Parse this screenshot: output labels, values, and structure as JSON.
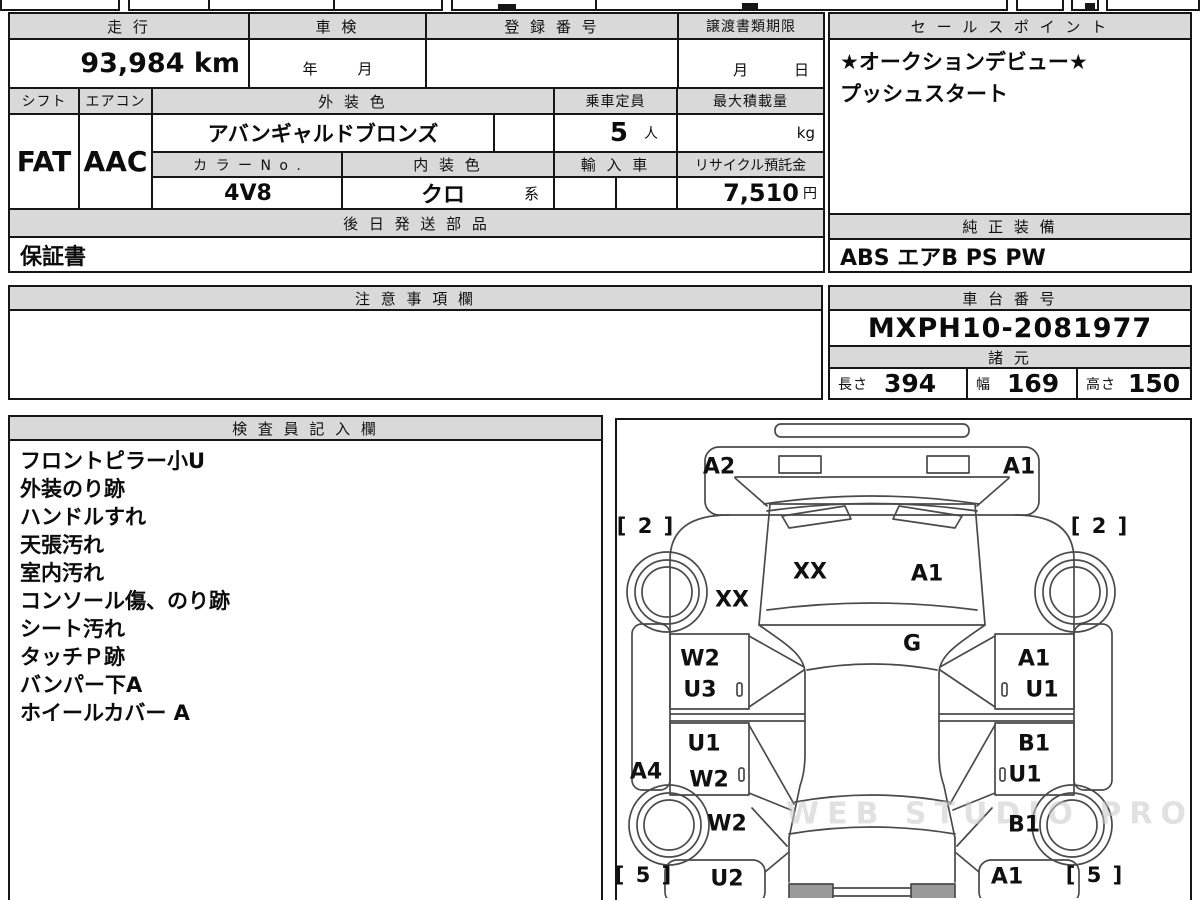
{
  "sheet": {
    "top": {
      "mileage_label": "走 行",
      "mileage_value": "93,984 km",
      "shaken_label": "車 検",
      "shaken_year": "年",
      "shaken_month": "月",
      "registration_label": "登 録 番 号",
      "registration_value": "",
      "transfer_label": "譲渡書類期限",
      "transfer_month": "月",
      "transfer_day": "日",
      "sales_point_label": "セ ー ル ス ポ イ ン ト",
      "sales_point_line1": "★オークションデビュー★",
      "sales_point_line2": "プッシュスタート"
    },
    "spec": {
      "shift_label": "シフト",
      "shift_value": "FAT",
      "aircon_label": "エアコン",
      "aircon_value": "AAC",
      "exterior_color_label": "外 装 色",
      "exterior_color_value": "アバンギャルドブロンズ",
      "capacity_label": "乗車定員",
      "capacity_value": "5",
      "capacity_unit": "人",
      "max_load_label": "最大積載量",
      "max_load_unit": "kg",
      "color_no_label": "カ ラ ー N o .",
      "color_no_value": "4V8",
      "interior_color_label": "内 装 色",
      "interior_color_value": "クロ",
      "interior_color_suffix": "系",
      "import_label": "輸 入 車",
      "recycle_label": "リサイクル預託金",
      "recycle_value": "7,510",
      "recycle_unit": "円"
    },
    "later_parts": {
      "label": "後 日 発 送 部 品",
      "value": "保証書"
    },
    "genuine_equipment": {
      "label": "純 正 装 備",
      "value": "ABS エアB PS PW"
    },
    "notes": {
      "label": "注 意 事 項 欄",
      "value": ""
    },
    "chassis": {
      "label": "車 台 番 号",
      "value": "MXPH10-2081977"
    },
    "dimensions": {
      "label": "諸 元",
      "length_label": "長さ",
      "length_value": "394",
      "width_label": "幅",
      "width_value": "169",
      "height_label": "高さ",
      "height_value": "150"
    },
    "inspector": {
      "label": "検 査 員 記 入 欄",
      "lines": [
        "フロントピラー小U",
        "外装のり跡",
        "ハンドルすれ",
        "天張汚れ",
        "室内汚れ",
        "コンソール傷、のり跡",
        "シート汚れ",
        "タッチＰ跡",
        "バンパー下A",
        "ホイールカバー A"
      ]
    },
    "diagram": {
      "watermark": "WEB STUDIO PRO",
      "labels": [
        {
          "text": "A2"
        },
        {
          "text": "A1"
        },
        {
          "text": "[ 2 ]"
        },
        {
          "text": "[ 2 ]"
        },
        {
          "text": "XX"
        },
        {
          "text": "A1"
        },
        {
          "text": "XX"
        },
        {
          "text": "G"
        },
        {
          "text": "W2"
        },
        {
          "text": "U3"
        },
        {
          "text": "A1"
        },
        {
          "text": "U1"
        },
        {
          "text": "U1"
        },
        {
          "text": "W2"
        },
        {
          "text": "B1"
        },
        {
          "text": "U1"
        },
        {
          "text": "A4"
        },
        {
          "text": "W2"
        },
        {
          "text": "B1"
        },
        {
          "text": "U2"
        },
        {
          "text": "A1"
        },
        {
          "text": "[ 5 ]"
        },
        {
          "text": "[ 5 ]"
        }
      ]
    }
  }
}
